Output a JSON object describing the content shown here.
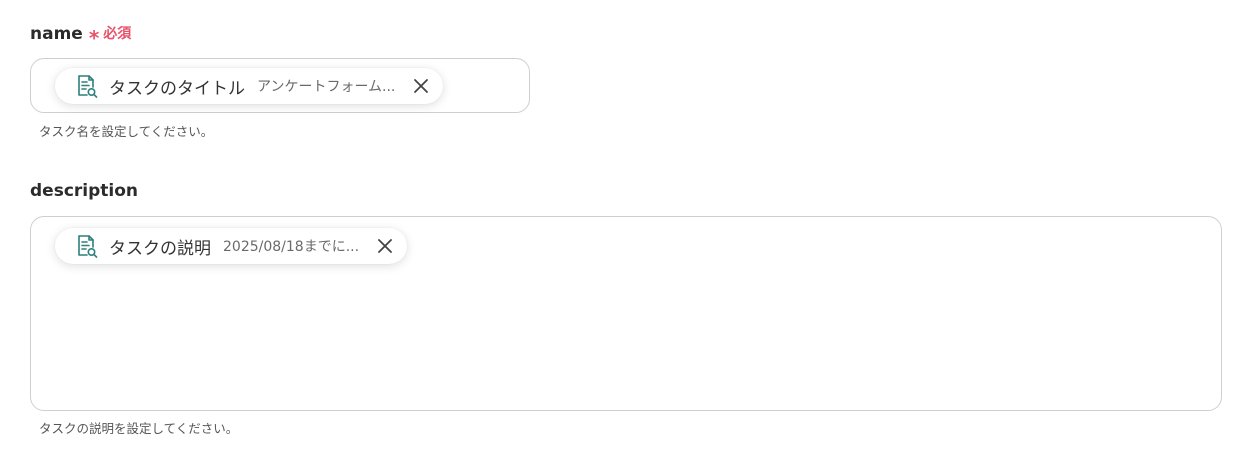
{
  "fields": {
    "name": {
      "label": "name",
      "required_mark": "*",
      "required_text": "必須",
      "chip": {
        "icon": "document-search-icon",
        "title": "タスクのタイトル",
        "value": "アンケートフォーム..."
      },
      "help": "タスク名を設定してください。"
    },
    "description": {
      "label": "description",
      "chip": {
        "icon": "document-search-icon",
        "title": "タスクの説明",
        "value": "2025/08/18までに..."
      },
      "help": "タスクの説明を設定してください。"
    }
  },
  "colors": {
    "accent_required": "#e8526a",
    "chip_icon": "#2f7f7b",
    "border": "#cfcfcf"
  }
}
